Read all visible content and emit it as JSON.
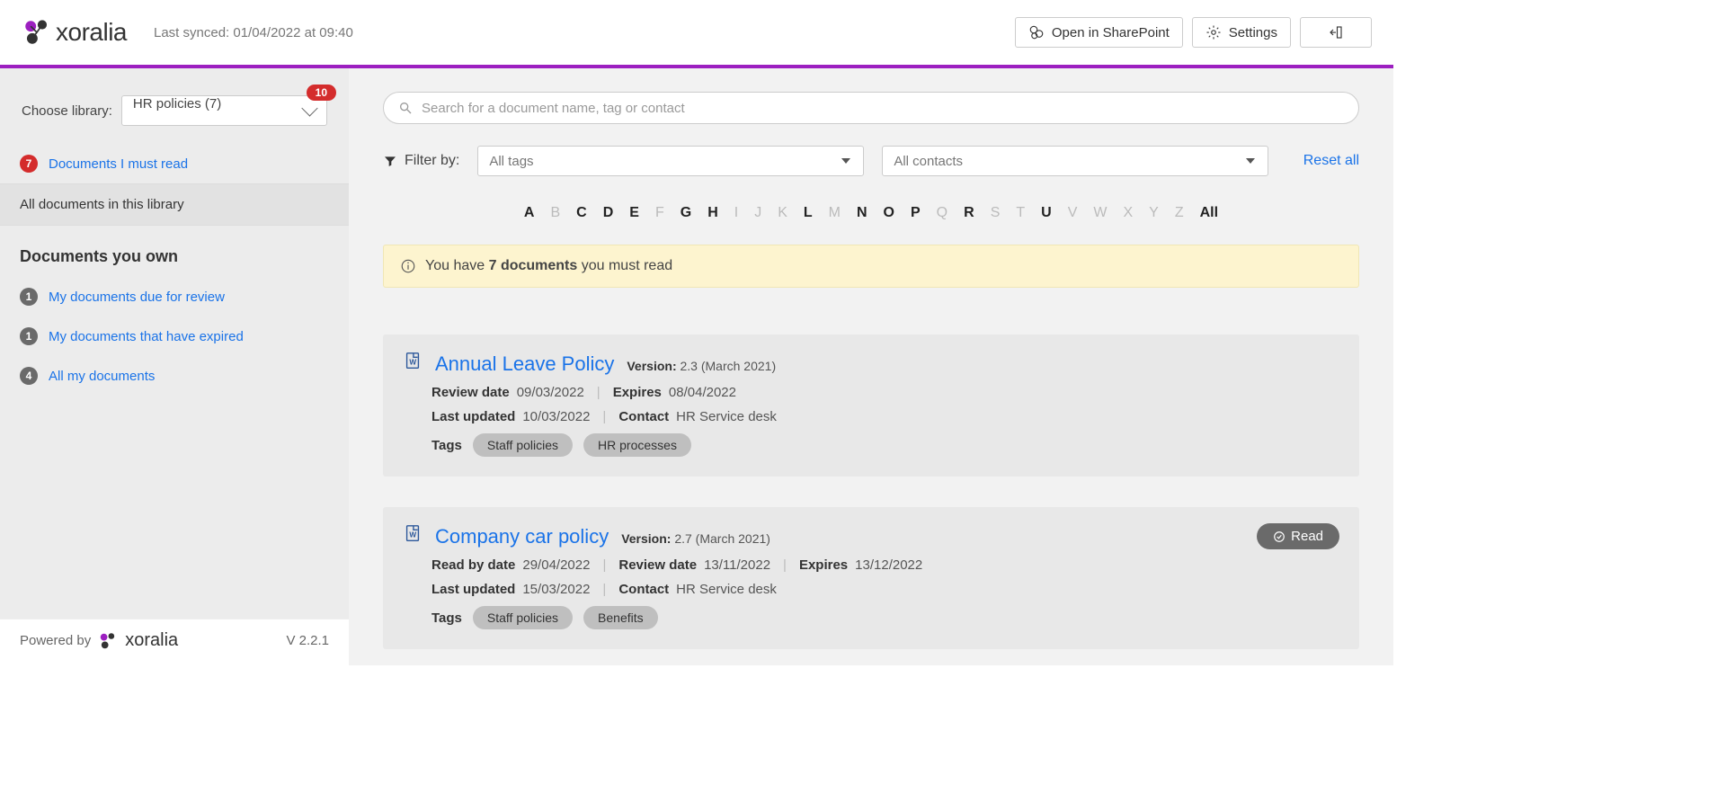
{
  "header": {
    "logo_text": "xoralia",
    "logo_bold_prefix": "x",
    "sync_text": "Last synced: 01/04/2022 at 09:40",
    "open_sharepoint": "Open in SharePoint",
    "settings": "Settings"
  },
  "sidebar": {
    "choose_library_label": "Choose library:",
    "library_selected": "HR policies (7)",
    "library_badge": "10",
    "must_read": {
      "badge": "7",
      "label": "Documents I must read"
    },
    "all_docs_label": "All documents in this library",
    "own_section_title": "Documents you own",
    "due_review": {
      "badge": "1",
      "label": "My documents due for review"
    },
    "expired": {
      "badge": "1",
      "label": "My documents that have expired"
    },
    "all_mine": {
      "badge": "4",
      "label": "All my documents"
    },
    "powered_by": "Powered by",
    "powered_brand": "xoralia",
    "version": "V 2.2.1"
  },
  "main": {
    "search_placeholder": "Search for a document name, tag or contact",
    "filter_label": "Filter by:",
    "tags_select": "All tags",
    "contacts_select": "All contacts",
    "reset": "Reset all",
    "alpha": [
      {
        "l": "A",
        "e": true
      },
      {
        "l": "B",
        "e": false
      },
      {
        "l": "C",
        "e": true
      },
      {
        "l": "D",
        "e": true
      },
      {
        "l": "E",
        "e": true
      },
      {
        "l": "F",
        "e": false
      },
      {
        "l": "G",
        "e": true
      },
      {
        "l": "H",
        "e": true
      },
      {
        "l": "I",
        "e": false
      },
      {
        "l": "J",
        "e": false
      },
      {
        "l": "K",
        "e": false
      },
      {
        "l": "L",
        "e": true
      },
      {
        "l": "M",
        "e": false
      },
      {
        "l": "N",
        "e": true
      },
      {
        "l": "O",
        "e": true
      },
      {
        "l": "P",
        "e": true
      },
      {
        "l": "Q",
        "e": false
      },
      {
        "l": "R",
        "e": true
      },
      {
        "l": "S",
        "e": false
      },
      {
        "l": "T",
        "e": false
      },
      {
        "l": "U",
        "e": true
      },
      {
        "l": "V",
        "e": false
      },
      {
        "l": "W",
        "e": false
      },
      {
        "l": "X",
        "e": false
      },
      {
        "l": "Y",
        "e": false
      },
      {
        "l": "Z",
        "e": false
      },
      {
        "l": "All",
        "e": true
      }
    ],
    "banner_prefix": "You have ",
    "banner_bold": "7 documents",
    "banner_suffix": " you must read",
    "documents": [
      {
        "title": "Annual Leave Policy",
        "version_label": "Version:",
        "version_value": "2.3 (March 2021)",
        "rows": [
          [
            {
              "lbl": "Review date",
              "val": "09/03/2022"
            },
            {
              "lbl": "Expires",
              "val": "08/04/2022"
            }
          ],
          [
            {
              "lbl": "Last updated",
              "val": "10/03/2022"
            },
            {
              "lbl": "Contact",
              "val": "HR Service desk"
            }
          ]
        ],
        "tags_label": "Tags",
        "tags": [
          "Staff policies",
          "HR processes"
        ],
        "read_badge": null
      },
      {
        "title": "Company car policy",
        "version_label": "Version:",
        "version_value": "2.7 (March 2021)",
        "rows": [
          [
            {
              "lbl": "Read by date",
              "val": "29/04/2022"
            },
            {
              "lbl": "Review date",
              "val": "13/11/2022"
            },
            {
              "lbl": "Expires",
              "val": "13/12/2022"
            }
          ],
          [
            {
              "lbl": "Last updated",
              "val": "15/03/2022"
            },
            {
              "lbl": "Contact",
              "val": "HR Service desk"
            }
          ]
        ],
        "tags_label": "Tags",
        "tags": [
          "Staff policies",
          "Benefits"
        ],
        "read_badge": "Read"
      }
    ]
  }
}
